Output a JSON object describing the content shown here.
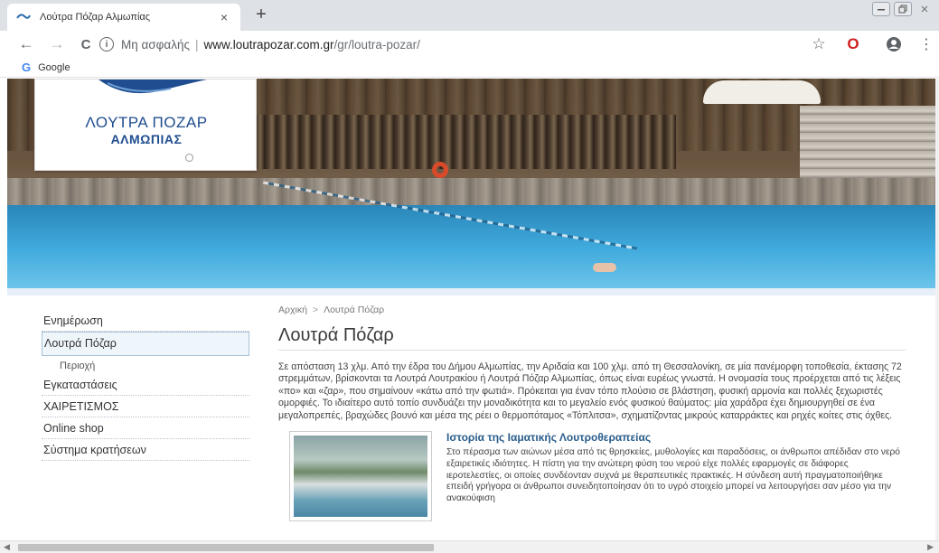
{
  "browser": {
    "tab_title": "Λούτρα Πόζαρ Αλμωπίας",
    "tab_close": "×",
    "new_tab": "+",
    "address": {
      "security": "Μη ασφαλής",
      "separator": "|",
      "host": "www.loutrapozar.com.gr",
      "path": "/gr/loutra-pozar/"
    },
    "bookmark_google": "Google",
    "bookmark_g": "G"
  },
  "logo": {
    "line1": "ΛΟΥΤΡΑ ΠΟΖΑΡ",
    "line2": "ΑΛΜΩΠΙΑΣ"
  },
  "sidebar": {
    "items": [
      {
        "label": "Ενημέρωση"
      },
      {
        "label": "Λουτρά Πόζαρ"
      },
      {
        "label": "Περιοχή"
      },
      {
        "label": "Εγκαταστάσεις"
      },
      {
        "label": "ΧΑΙΡΕΤΙΣΜΟΣ"
      },
      {
        "label": "Online shop"
      },
      {
        "label": "Σύστημα κρατήσεων"
      }
    ]
  },
  "main": {
    "breadcrumb": {
      "home": "Αρχική",
      "sep": ">",
      "current": "Λουτρά Πόζαρ"
    },
    "title": "Λουτρά Πόζαρ",
    "intro": "Σε απόσταση 13 χλμ. Από την έδρα του Δήμου Αλμωπίας, την Αριδαία και 100 χλμ. από τη Θεσσαλονίκη, σε μία πανέμορφη τοποθεσία, έκτασης 72 στρεμμάτων, βρίσκονται τα Λουτρά Λουτρακίου ή Λουτρά Πόζαρ Αλμωπίας, όπως είναι ευρέως γνωστά. Η ονομασία τους προέρχεται από τις λέξεις «πο» και «ζαρ», που σημαίνουν «κάτω από την φωτιά». Πρόκειται για έναν τόπο πλούσιο σε βλάστηση, φυσική αρμονία και πολλές ξεχωριστές ομορφιές. Το ιδιαίτερο αυτό τοπίο συνδυάζει την μοναδικότητα και το μεγαλείο ενός φυσικού θαύματος: μία χαράδρα έχει δημιουργηθεί σε ένα μεγαλοπρεπές, βραχώδες βουνό και μέσα της ρέει ο θερμοπόταμος «Τόπλιτσα», σχηματίζοντας μικρούς καταρράκτες και ρηχές κοίτες στις όχθες.",
    "article": {
      "title": "Ιστορία της Ιαματικής Λουτροθεραπείας",
      "text": "Στο πέρασμα των αιώνων μέσα από τις θρησκείες, μυθολογίες και παραδόσεις, οι άνθρωποι απέδιδαν στο νερό εξαιρετικές ιδιότητες. Η πίστη για την ανώτερη φύση του νερού είχε πολλές εφαρμογές σε διάφορες ιεροτελεστίες, οι οποίες συνδέονταν συχνά με θεραπευτικές πρακτικές. Η σύνδεση αυτή πραγματοποιήθηκε επειδή γρήγορα οι άνθρωποι συνειδητοποίησαν ότι το υγρό στοιχείο μπορεί να λειτουργήσει σαν μέσο για την ανακούφιση"
    }
  },
  "icons": {
    "back": "←",
    "forward": "→",
    "reload": "C",
    "info": "i",
    "star": "☆",
    "opera": "O",
    "profile": "⊖",
    "menu": "⋮",
    "scroll_left": "◀",
    "scroll_right": "▶"
  },
  "colors": {
    "link_blue": "#2a5e8c",
    "logo_blue": "#1f4d8f",
    "opera_red": "#d01e1e"
  }
}
